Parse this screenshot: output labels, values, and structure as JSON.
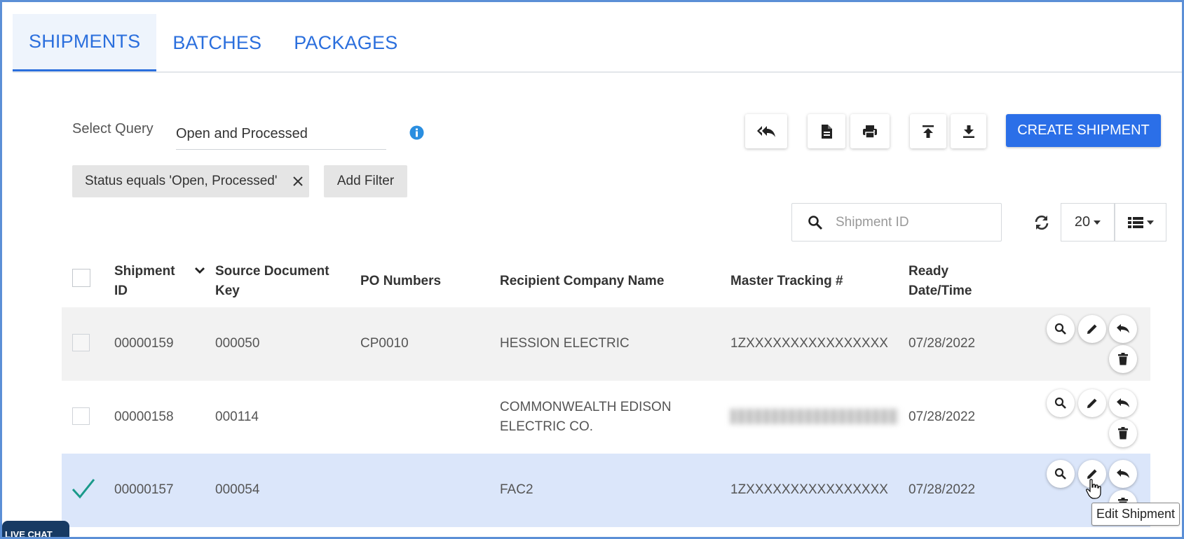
{
  "tabs": [
    {
      "label": "SHIPMENTS",
      "active": true
    },
    {
      "label": "BATCHES",
      "active": false
    },
    {
      "label": "PACKAGES",
      "active": false
    }
  ],
  "query": {
    "label": "Select Query",
    "value": "Open and Processed"
  },
  "toolbar": {
    "create_label": "CREATE SHIPMENT",
    "icons": [
      "reply-all-icon",
      "document-icon",
      "print-icon",
      "upload-icon",
      "download-icon"
    ]
  },
  "filters": {
    "chip": "Status equals 'Open, Processed'",
    "add_label": "Add Filter"
  },
  "search": {
    "placeholder": "Shipment ID"
  },
  "page_size": "20",
  "columns": {
    "shipment_id_1": "Shipment",
    "shipment_id_2": "ID",
    "source_key_1": "Source Document",
    "source_key_2": "Key",
    "po_numbers": "PO Numbers",
    "recipient": "Recipient Company Name",
    "tracking": "Master Tracking #",
    "ready_1": "Ready",
    "ready_2": "Date/Time"
  },
  "rows": [
    {
      "shipment_id": "00000159",
      "source_key": "000050",
      "po_numbers": "CP0010",
      "recipient_1": "HESSION ELECTRIC",
      "recipient_2": "",
      "tracking": "1ZXXXXXXXXXXXXXXXX",
      "ready": "07/28/2022",
      "selected": false
    },
    {
      "shipment_id": "00000158",
      "source_key": "000114",
      "po_numbers": "",
      "recipient_1": "COMMONWEALTH EDISON",
      "recipient_2": "ELECTRIC CO.",
      "tracking": "",
      "ready": "07/28/2022",
      "selected": false
    },
    {
      "shipment_id": "00000157",
      "source_key": "000054",
      "po_numbers": "",
      "recipient_1": "FAC2",
      "recipient_2": "",
      "tracking": "1ZXXXXXXXXXXXXXXXX",
      "ready": "07/28/2022",
      "selected": true
    }
  ],
  "tooltip": "Edit Shipment",
  "livechat_label": "LIVE CHAT",
  "colors": {
    "accent": "#2b6fe8",
    "selected_row": "#dbe6fa",
    "alt_row": "#f2f2f2",
    "check": "#1a9a8a",
    "info": "#2a8ee0"
  }
}
